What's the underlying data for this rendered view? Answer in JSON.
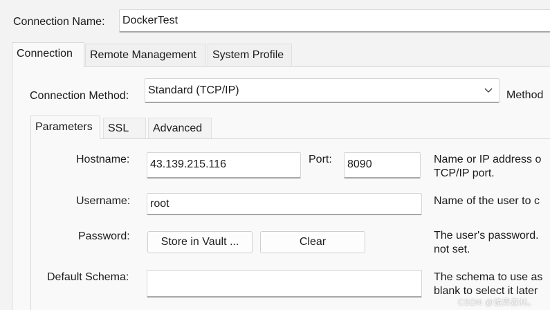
{
  "connection_name": {
    "label": "Connection Name:",
    "value": "DockerTest"
  },
  "tabs": [
    {
      "label": "Connection",
      "active": true
    },
    {
      "label": "Remote Management",
      "active": false
    },
    {
      "label": "System Profile",
      "active": false
    }
  ],
  "connection_method": {
    "label": "Connection Method:",
    "selected": "Standard (TCP/IP)",
    "description": "Method"
  },
  "subtabs": [
    {
      "label": "Parameters",
      "active": true
    },
    {
      "label": "SSL",
      "active": false
    },
    {
      "label": "Advanced",
      "active": false
    }
  ],
  "hostname": {
    "label": "Hostname:",
    "value": "43.139.215.116",
    "description": [
      "Name or IP address o",
      "TCP/IP port."
    ]
  },
  "port": {
    "label": "Port:",
    "value": "8090"
  },
  "username": {
    "label": "Username:",
    "value": "root",
    "description": [
      "Name of the user to c"
    ]
  },
  "password": {
    "label": "Password:",
    "store_button": "Store in Vault ...",
    "clear_button": "Clear",
    "description": [
      "The user's password.",
      "not set."
    ]
  },
  "default_schema": {
    "label": "Default Schema:",
    "value": "",
    "description": [
      "The schema to use as",
      "blank to select it later"
    ]
  },
  "watermark": "CSDN @诡异森林。",
  "icons": {
    "dropdown": "chevron-down-icon"
  }
}
